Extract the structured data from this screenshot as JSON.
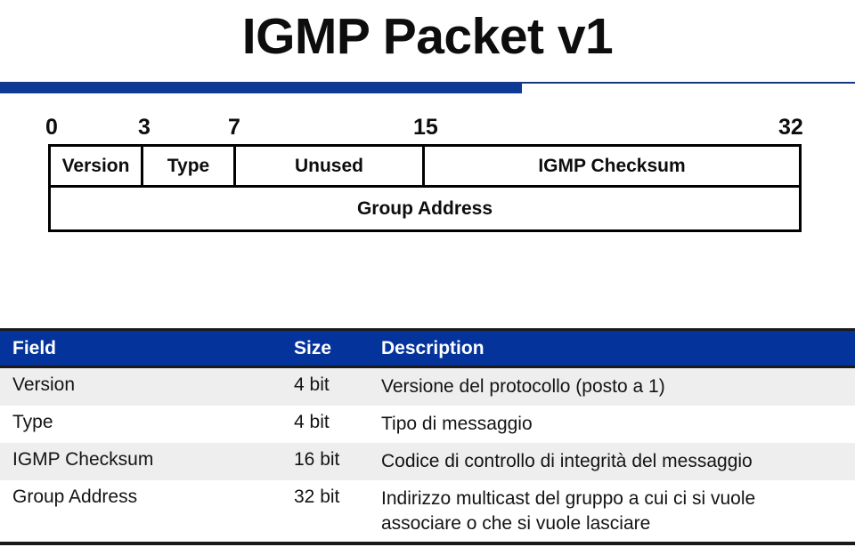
{
  "slide": {
    "title": "IGMP Packet v1",
    "accent_color": "#0c3a94",
    "header_band_color": "#04339b",
    "rule_color": "#1a1a1a",
    "shaded_row_color": "#eeeeee"
  },
  "packet_diagram": {
    "bit_ticks": [
      "0",
      "3",
      "7",
      "15",
      "32"
    ],
    "rows": [
      {
        "cells": [
          {
            "label": "Version"
          },
          {
            "label": "Type"
          },
          {
            "label": "Unused"
          },
          {
            "label": "IGMP Checksum"
          }
        ]
      },
      {
        "cells": [
          {
            "label": "Group Address"
          }
        ]
      }
    ]
  },
  "field_table": {
    "columns": [
      "Field",
      "Size",
      "Description"
    ],
    "rows": [
      {
        "field": "Version",
        "size": "4 bit",
        "description_lines": [
          "Versione del protocollo (posto a 1)"
        ]
      },
      {
        "field": "Type",
        "size": "4 bit",
        "description_lines": [
          "Tipo di messaggio"
        ]
      },
      {
        "field": "IGMP Checksum",
        "size": "16 bit",
        "description_lines": [
          "Codice di controllo di integrità del messaggio"
        ]
      },
      {
        "field": "Group Address",
        "size": "32 bit",
        "description_lines": [
          "Indirizzo multicast del gruppo a cui ci si vuole",
          "associare o che si vuole lasciare"
        ]
      }
    ]
  }
}
